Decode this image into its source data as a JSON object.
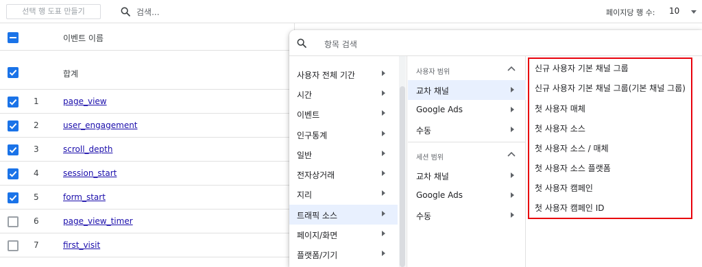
{
  "toolbar": {
    "chart_button": "선택 행 도표 만들기",
    "search_placeholder": "검색...",
    "rows_per_page_label": "페이지당 행 수:",
    "rows_per_page_value": "10"
  },
  "table": {
    "header_label": "이벤트 이름",
    "total_label": "합계",
    "rows": [
      {
        "num": "1",
        "name": "page_view",
        "checked": true
      },
      {
        "num": "2",
        "name": "user_engagement",
        "checked": true
      },
      {
        "num": "3",
        "name": "scroll_depth",
        "checked": true
      },
      {
        "num": "4",
        "name": "session_start",
        "checked": true
      },
      {
        "num": "5",
        "name": "form_start",
        "checked": true
      },
      {
        "num": "6",
        "name": "page_view_timer",
        "checked": false
      },
      {
        "num": "7",
        "name": "first_visit",
        "checked": false
      }
    ]
  },
  "panel": {
    "search_placeholder": "항목 검색",
    "categories": [
      "사용자 전체 기간",
      "시간",
      "이벤트",
      "인구통계",
      "일반",
      "전자상거래",
      "지리",
      "트래픽 소스",
      "페이지/화면",
      "플랫폼/기기"
    ],
    "active_category": "트래픽 소스",
    "sections": [
      {
        "title": "사용자 범위",
        "items": [
          "교차 채널",
          "Google Ads",
          "수동"
        ]
      },
      {
        "title": "세션 범위",
        "items": [
          "교차 채널",
          "Google Ads",
          "수동"
        ]
      }
    ],
    "options": [
      "신규 사용자 기본 채널 그룹",
      "신규 사용자 기본 채널 그룹(기본 채널 그룹)",
      "첫 사용자 매체",
      "첫 사용자 소스",
      "첫 사용자 소스 / 매체",
      "첫 사용자 소스 플랫폼",
      "첫 사용자 캠페인",
      "첫 사용자 캠페인 ID"
    ]
  },
  "colors": {
    "accent": "#1a73e8",
    "highlight": "#e8000b",
    "link": "#1a0dab"
  }
}
